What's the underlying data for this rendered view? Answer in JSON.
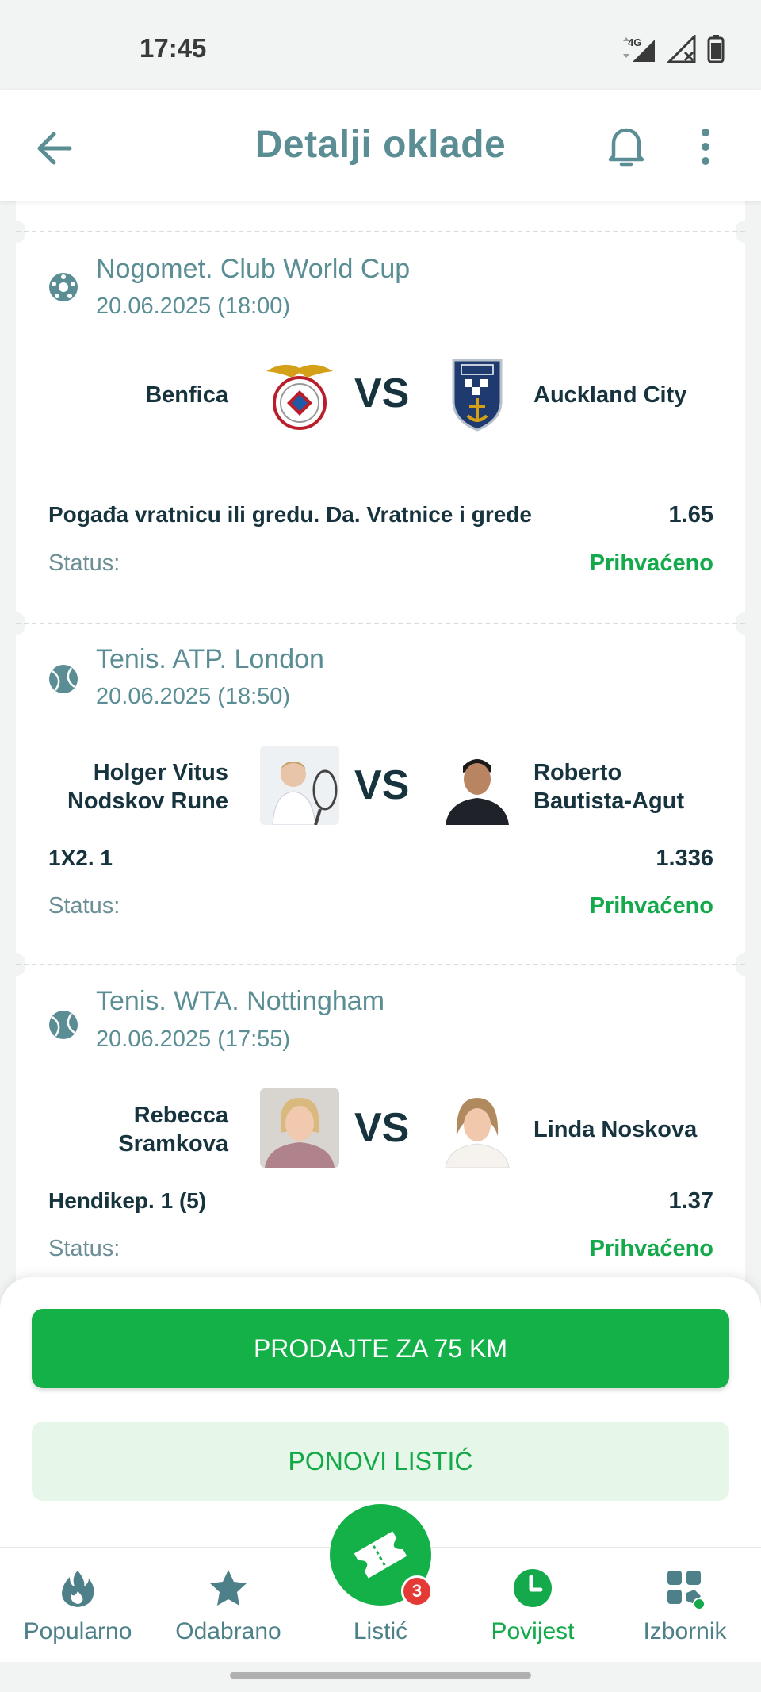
{
  "status_bar": {
    "time": "17:45",
    "network": "4G"
  },
  "header": {
    "title": "Detalji oklade"
  },
  "matches": [
    {
      "sport": "football",
      "league": "Nogomet. Club World Cup",
      "date": "20.06.2025 (18:00)",
      "home": "Benfica",
      "away": "Auckland City",
      "vs": "VS",
      "market": "Pogađa vratnicu ili gredu. Da. Vratnice i grede",
      "odds": "1.65",
      "status_label": "Status:",
      "status_value": "Prihvaćeno"
    },
    {
      "sport": "tennis",
      "league": "Tenis. ATP. London",
      "date": "20.06.2025 (18:50)",
      "home": "Holger Vitus Nodskov Rune",
      "away": "Roberto Bautista-Agut",
      "vs": "VS",
      "market": "1X2. 1",
      "odds": "1.336",
      "status_label": "Status:",
      "status_value": "Prihvaćeno"
    },
    {
      "sport": "tennis",
      "league": "Tenis. WTA. Nottingham",
      "date": "20.06.2025 (17:55)",
      "home": "Rebecca Sramkova",
      "away": "Linda Noskova",
      "vs": "VS",
      "market": "Hendikep. 1 (5)",
      "odds": "1.37",
      "status_label": "Status:",
      "status_value": "Prihvaćeno"
    }
  ],
  "actions": {
    "sell": "PRODAJTE ZA 75 KM",
    "repeat": "PONOVI LISTIĆ"
  },
  "nav": {
    "items": [
      {
        "label": "Popularno",
        "icon": "flame-icon"
      },
      {
        "label": "Odabrano",
        "icon": "star-icon"
      },
      {
        "label": "Listić",
        "icon": "ticket-icon",
        "badge": "3"
      },
      {
        "label": "Povijest",
        "icon": "clock-icon",
        "active": true
      },
      {
        "label": "Izbornik",
        "icon": "grid-icon"
      }
    ]
  },
  "colors": {
    "accent": "#13b147",
    "teal": "#5a8e94",
    "text": "#17343e",
    "badge": "#e53935"
  }
}
